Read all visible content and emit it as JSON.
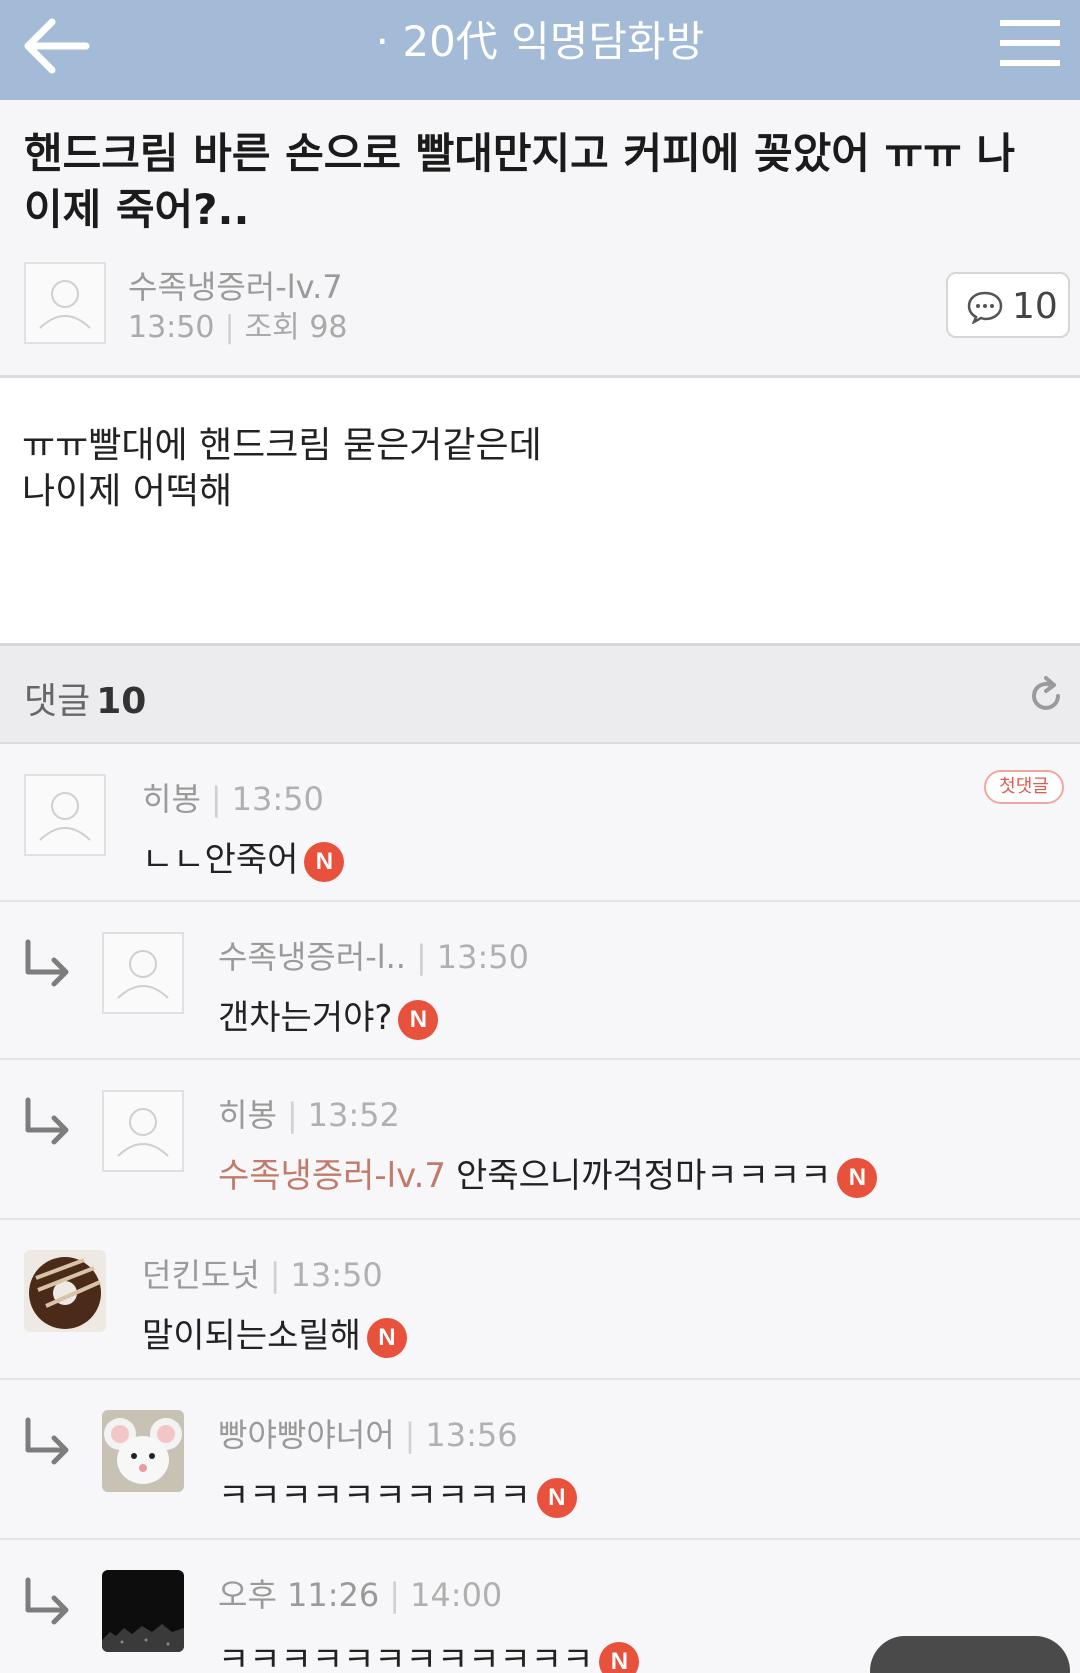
{
  "header": {
    "board_title": "· 20代 익명담화방",
    "back_icon": "arrow-left-icon",
    "menu_icon": "hamburger-menu-icon"
  },
  "post": {
    "title": "핸드크림 바른 손으로 빨대만지고 커피에 꽂았어 ㅠㅠ 나 이제 죽어?..",
    "author": "수족냉증러-lv.7",
    "time": "13:50",
    "views_label": "조회 98",
    "comment_count": "10",
    "body_lines": [
      "ㅠㅠ빨대에 핸드크림 묻은거같은데",
      "나이제 어떡해"
    ]
  },
  "comments_header": {
    "label": "댓글",
    "count": "10"
  },
  "comments": [
    {
      "name": "히봉",
      "time": "13:50",
      "text": "ㄴㄴ안죽어",
      "new_badge": "N",
      "first_badge": "첫댓글",
      "avatar": "blank-avatar-icon"
    },
    {
      "name": "수족냉증러-l..",
      "time": "13:50",
      "text": "갠차는거야?",
      "new_badge": "N",
      "avatar": "blank-avatar-icon"
    },
    {
      "name": "히봉",
      "time": "13:52",
      "mention": "수족냉증러-lv.7",
      "text": "안죽으니까걱정마ㅋㅋㅋㅋ",
      "new_badge": "N",
      "avatar": "blank-avatar-icon"
    },
    {
      "name": "던킨도넛",
      "time": "13:50",
      "text": "말이되는소릴해",
      "new_badge": "N",
      "avatar": "donut-avatar"
    },
    {
      "name": "빵야빵야너어",
      "time": "13:56",
      "text": "ㅋㅋㅋㅋㅋㅋㅋㅋㅋㅋ",
      "new_badge": "N",
      "avatar": "mouse-avatar"
    },
    {
      "name": "오후 11:26",
      "time": "14:00",
      "text": "ㅋㅋㅋㅋㅋㅋㅋㅋㅋㅋㅋㅋ",
      "new_badge": "N",
      "avatar": "black-avatar"
    }
  ],
  "colors": {
    "header_bg": "#a3bbd6",
    "badge_red": "#e8513b",
    "mention": "#c07b6b"
  }
}
